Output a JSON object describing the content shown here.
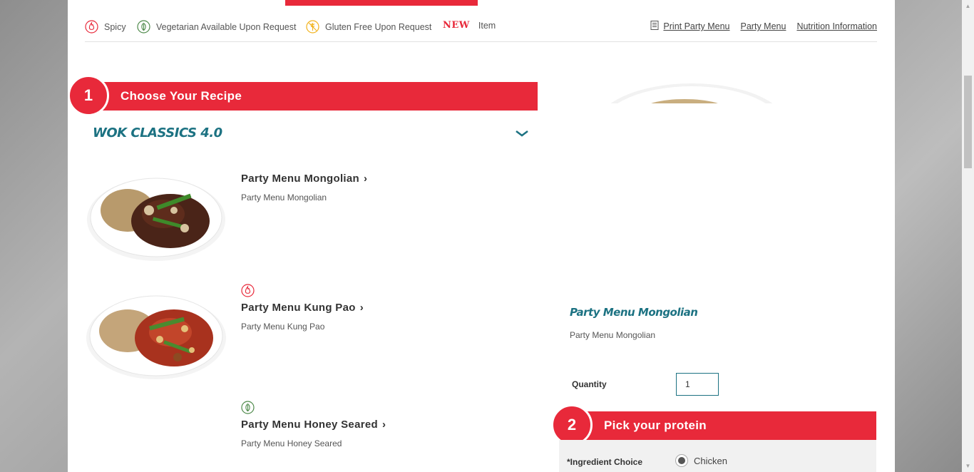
{
  "legend": {
    "spicy": "Spicy",
    "vegetarian": "Vegetarian Available Upon Request",
    "gluten_free": "Gluten Free Upon Request",
    "new_badge": "NEW",
    "new_item": "Item"
  },
  "top_links": {
    "print": "Print Party Menu",
    "party_menu": "Party Menu",
    "nutrition": "Nutrition Information"
  },
  "step1": {
    "number": "1",
    "label": "Choose Your Recipe"
  },
  "category": {
    "title": "WOK CLASSICS 4.0",
    "chevron": "❯"
  },
  "items": [
    {
      "name": "Party Menu Mongolian",
      "desc": "Party Menu Mongolian",
      "icon": null
    },
    {
      "name": "Party Menu Kung Pao",
      "desc": "Party Menu Kung Pao",
      "icon": "spicy-icon"
    },
    {
      "name": "Party Menu Honey Seared",
      "desc": "Party Menu Honey Seared",
      "icon": "vegetarian-icon"
    }
  ],
  "arrow": "›",
  "preview": {
    "title": "Party Menu Mongolian",
    "desc": "Party Menu Mongolian",
    "quantity_label": "Quantity",
    "quantity_value": "1"
  },
  "step2": {
    "number": "2",
    "label": "Pick your protein"
  },
  "protein": {
    "ingredient_label": "*Ingredient Choice",
    "option": "Chicken"
  },
  "colors": {
    "accent": "#e8293a",
    "teal": "#1c7282"
  }
}
